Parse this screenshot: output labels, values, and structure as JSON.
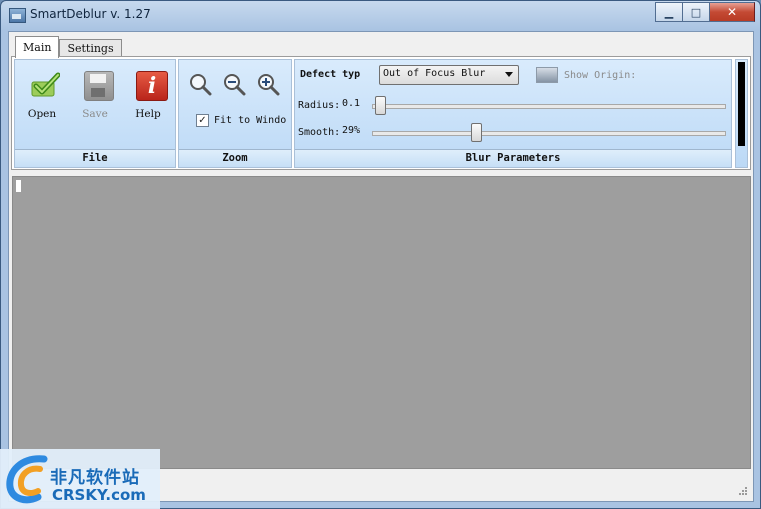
{
  "window": {
    "title": "SmartDeblur v. 1.27"
  },
  "tabs": [
    {
      "label": "Main"
    },
    {
      "label": "Settings"
    }
  ],
  "file_group": {
    "label": "File",
    "open_label": "Open",
    "save_label": "Save",
    "help_label": "Help",
    "help_glyph": "i"
  },
  "zoom_group": {
    "label": "Zoom",
    "fit_label": "Fit to Windo",
    "fit_checked": true,
    "check_glyph": "✓"
  },
  "blur_group": {
    "label": "Blur Parameters",
    "defect_label": "Defect typ",
    "defect_value": "Out of Focus Blur",
    "show_original_label": "Show Origin:",
    "radius_label": "Radius:",
    "radius_value": "0.1",
    "smooth_label": "Smooth:",
    "smooth_value": "29%",
    "radius_level": 0.01,
    "smooth_level": 0.29
  },
  "watermark": {
    "cn": "非凡软件站",
    "en": "CRSKY.com"
  },
  "colors": {
    "accent": "#1a6bb8",
    "canvas": "#9e9e9e",
    "close_button": "#c44a34"
  }
}
